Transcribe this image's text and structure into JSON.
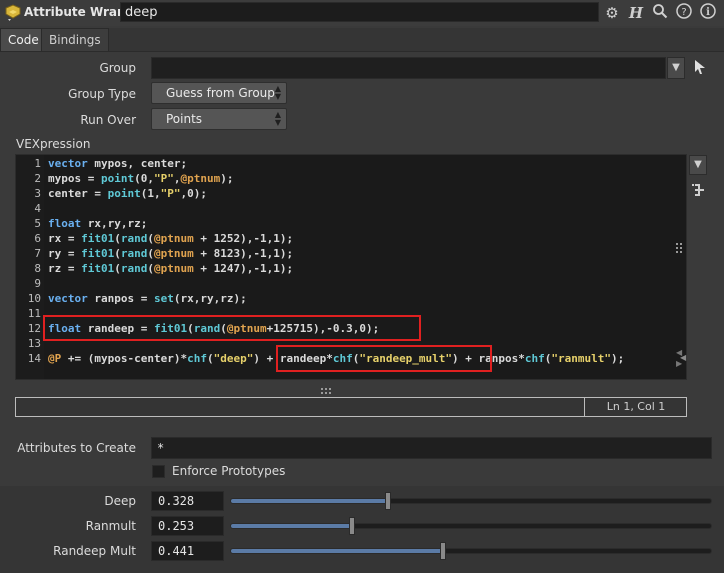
{
  "header": {
    "node_type": "Attribute Wrangle",
    "node_name": "deep",
    "icons": [
      "gear-icon",
      "help-h-icon",
      "search-icon",
      "help-icon",
      "info-icon"
    ]
  },
  "tabs": [
    {
      "label": "Code",
      "active": true
    },
    {
      "label": "Bindings",
      "active": false
    }
  ],
  "parms": {
    "group_label": "Group",
    "group_value": "",
    "group_type_label": "Group Type",
    "group_type_value": "Guess from Group",
    "run_over_label": "Run Over",
    "run_over_value": "Points",
    "vexpression_label": "VEXpression"
  },
  "code": {
    "line_numbers": [
      "1",
      "2",
      "3",
      "4",
      "5",
      "6",
      "7",
      "8",
      "9",
      "10",
      "11",
      "12",
      "13",
      "14"
    ],
    "lines": [
      "vector mypos, center;",
      "mypos = point(0,\"P\",@ptnum);",
      "center = point(1,\"P\",0);",
      "",
      "float rx,ry,rz;",
      "rx = fit01(rand(@ptnum + 1252),-1,1);",
      "ry = fit01(rand(@ptnum + 8123),-1,1);",
      "rz = fit01(rand(@ptnum + 1247),-1,1);",
      "",
      "vector ranpos = set(rx,ry,rz);",
      "",
      "float randeep = fit01(rand(@ptnum+125715),-0.3,0);",
      "",
      "@P += (mypos-center)*chf(\"deep\") + randeep*chf(\"randeep_mult\") + ranpos*chf(\"ranmult\");"
    ],
    "status": "Ln 1, Col 1",
    "highlight_color": "#e02020"
  },
  "attributes_to_create": {
    "label": "Attributes to Create",
    "value": "*"
  },
  "enforce_prototypes": {
    "label": "Enforce Prototypes",
    "checked": false
  },
  "sliders": [
    {
      "label": "Deep",
      "value": "0.328",
      "fraction": 0.328
    },
    {
      "label": "Ranmult",
      "value": "0.253",
      "fraction": 0.253
    },
    {
      "label": "Randeep Mult",
      "value": "0.441",
      "fraction": 0.441
    }
  ],
  "colors": {
    "accent": "#5b7ba6",
    "keyword": "#6ab0f0",
    "function": "#5fc9d6",
    "string": "#e6d06a",
    "attribute": "#e0a34f"
  }
}
